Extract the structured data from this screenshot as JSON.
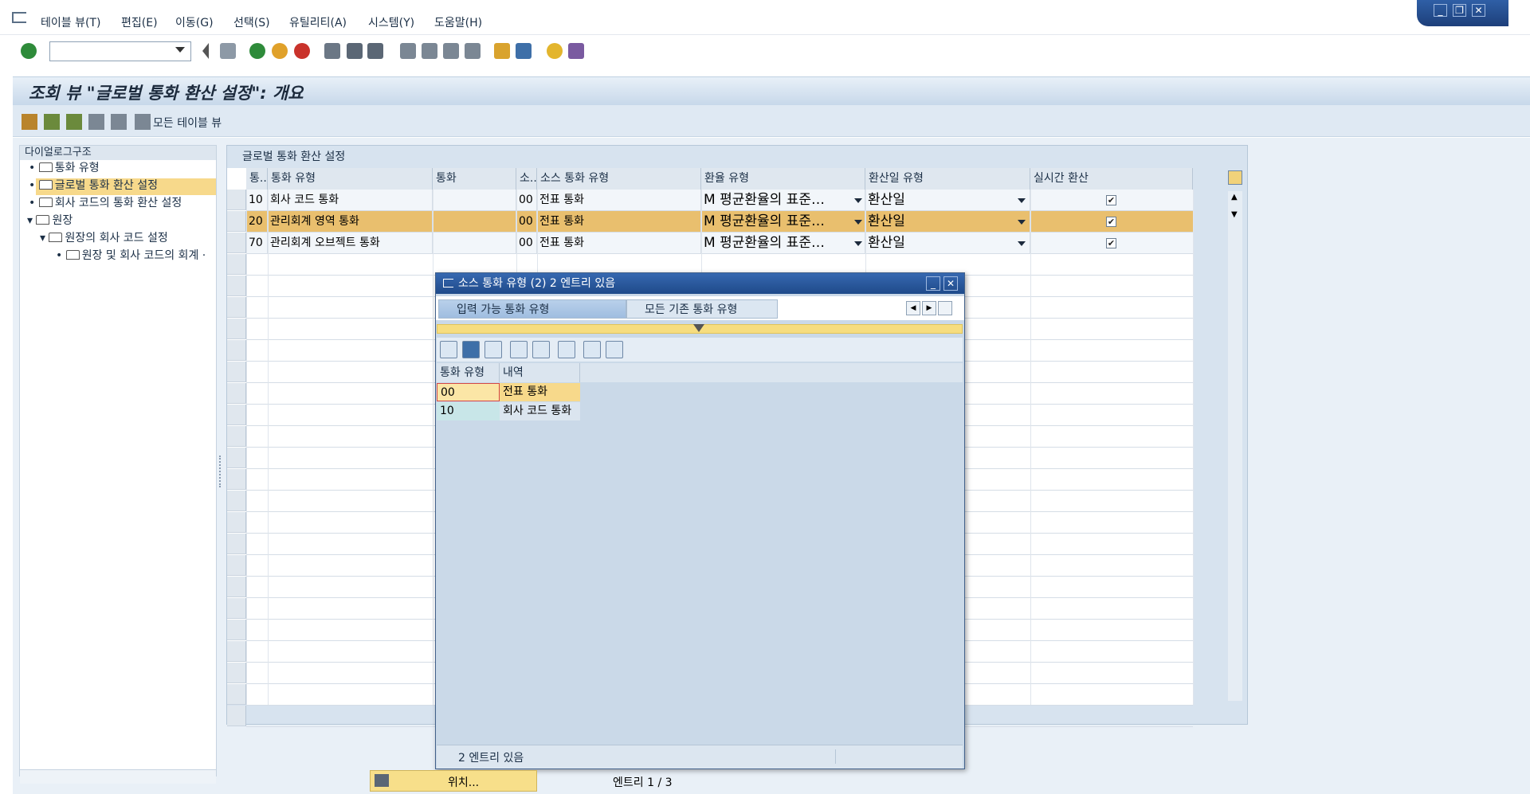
{
  "menu": {
    "items": [
      "테이블 뷰(T)",
      "편집(E)",
      "이동(G)",
      "선택(S)",
      "유틸리티(A)",
      "시스템(Y)",
      "도움말(H)"
    ]
  },
  "window_controls": {
    "minimize": "_",
    "restore": "❐",
    "close": "✕"
  },
  "header": {
    "title": "조회 뷰 \"글로벌 통화 환산 설정\": 개요"
  },
  "app_toolbar": {
    "all_tables_label": "모든 테이블 뷰"
  },
  "tree": {
    "header": "다이얼로그구조",
    "items": [
      "통화 유형",
      "글로벌 통화 환산 설정",
      "회사 코드의 통화 환산 설정",
      "원장",
      "원장의 회사 코드 설정",
      "원장 및 회사 코드의 회계 ·"
    ]
  },
  "panel": {
    "title": "글로벌 통화 환산 설정"
  },
  "table": {
    "columns": [
      "통..",
      "통화 유형",
      "통화",
      "소..",
      "소스 통화 유형",
      "환율 유형",
      "환산일 유형",
      "실시간 환산"
    ],
    "rows": [
      {
        "code": "10",
        "name": "회사 코드 통화",
        "currency": "",
        "src": "00",
        "src_type": "전표 통화",
        "rate": "M 평균환율의 표준…",
        "date": "환산일",
        "realtime": true
      },
      {
        "code": "20",
        "name": "관리회계 영역 통화",
        "currency": "",
        "src": "00",
        "src_type": "전표 통화",
        "rate": "M 평균환율의 표준…",
        "date": "환산일",
        "realtime": true
      },
      {
        "code": "70",
        "name": "관리회계 오브젝트 통화",
        "currency": "",
        "src": "00",
        "src_type": "전표 통화",
        "rate": "M 평균환율의 표준…",
        "date": "환산일",
        "realtime": true
      }
    ]
  },
  "dialog": {
    "title": "소스 통화 유형 (2)   2 엔트리 있음",
    "tabs": [
      "입력 가능 통화 유형",
      "모든 기존 통화 유형"
    ],
    "columns": [
      "통화 유형",
      "내역"
    ],
    "rows": [
      {
        "code": "00",
        "desc": "전표 통화"
      },
      {
        "code": "10",
        "desc": "회사 코드 통화"
      }
    ],
    "status": "2 엔트리 있음"
  },
  "footer": {
    "position_button": "위치...",
    "entry_info": "엔트리 1 / 3"
  },
  "colors": {
    "selected_row": "#e9bf6e",
    "accent_blue": "#1f4a8a",
    "highlight_yellow": "#f7d98b"
  }
}
